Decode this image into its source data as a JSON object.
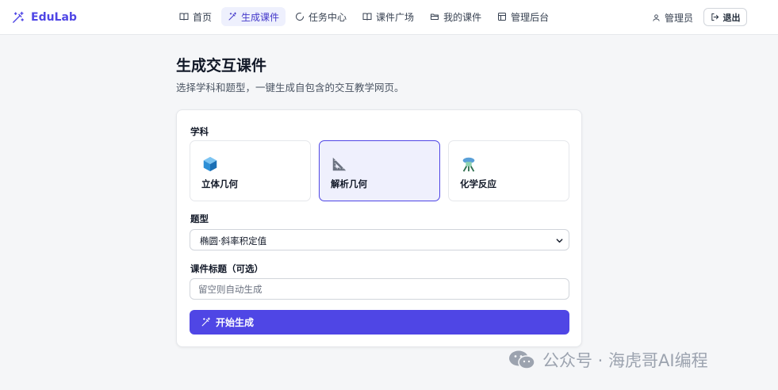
{
  "brand": {
    "name": "EduLab",
    "color": "#4f46e5"
  },
  "nav": {
    "items": [
      {
        "label": "首页",
        "icon": "book-icon",
        "active": false
      },
      {
        "label": "生成课件",
        "icon": "magic-wand-icon",
        "active": true
      },
      {
        "label": "任务中心",
        "icon": "spinner-icon",
        "active": false
      },
      {
        "label": "课件广场",
        "icon": "book-icon",
        "active": false
      },
      {
        "label": "我的课件",
        "icon": "folder-icon",
        "active": false
      },
      {
        "label": "管理后台",
        "icon": "dashboard-icon",
        "active": false
      }
    ]
  },
  "user": {
    "name": "管理员",
    "icon": "user-icon"
  },
  "logout": {
    "label": "退出",
    "icon": "logout-icon"
  },
  "page": {
    "title": "生成交互课件",
    "subtitle": "选择学科和题型，一键生成自包含的交互教学网页。"
  },
  "form": {
    "subject_label": "学科",
    "subjects": [
      {
        "label": "立体几何",
        "icon": "cube-icon",
        "selected": false
      },
      {
        "label": "解析几何",
        "icon": "triangle-ruler-icon",
        "selected": true
      },
      {
        "label": "化学反应",
        "icon": "microscope-icon",
        "selected": false
      }
    ],
    "type_label": "题型",
    "type_value": "椭圆·斜率积定值",
    "title_label": "课件标题（可选）",
    "title_placeholder": "留空则自动生成",
    "title_value": "",
    "submit_label": "开始生成",
    "accent": "#4f46e5"
  },
  "watermark": {
    "text": "公众号 · 海虎哥AI编程",
    "icon": "wechat-icon"
  }
}
